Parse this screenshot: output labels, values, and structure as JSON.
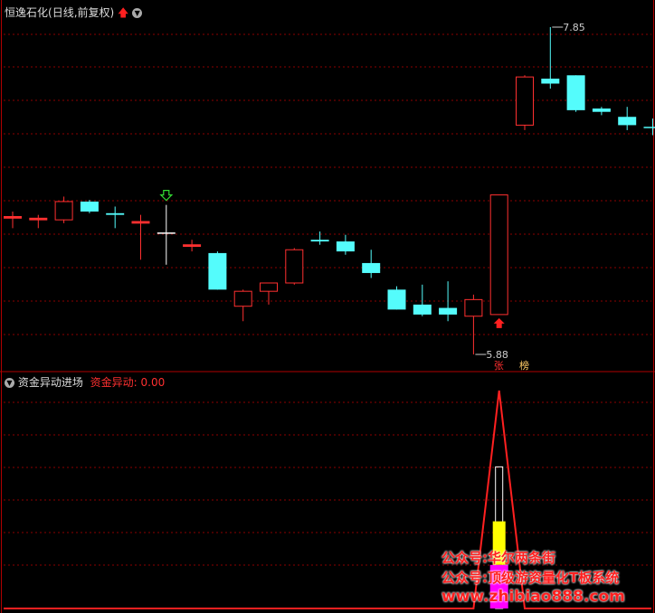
{
  "header": {
    "stock_name": "恒逸石化",
    "mode": "(日线,前复权)",
    "up_arrow_icon": "red-up-arrow-icon",
    "dropdown_icon": "chevron-down-circle-icon"
  },
  "indicator": {
    "name": "资金异动进场",
    "value_label": "资金异动:",
    "value": "0.00"
  },
  "annotations": {
    "high_label": "7.85",
    "low_label": "5.88",
    "tag_zhang": "张",
    "tag_bang": "榜"
  },
  "watermark": {
    "line1": "公众号:华尔两条街",
    "line2": "公众号:顶级游资量化T板系统",
    "line3": "www.zhibiao888.com"
  },
  "colors": {
    "up": "#ff3030",
    "down": "#54fcfc",
    "doji": "#ffffff",
    "grid": "#8b0000",
    "volume_line": "#ff2020",
    "bar_yellow": "#ffff00",
    "bar_magenta": "#ff00ff",
    "bar_white": "#ffffff"
  },
  "chart_data": {
    "type": "candlestick",
    "price_range": [
      5.8,
      8.0
    ],
    "candles": [
      {
        "o": 6.71,
        "h": 6.74,
        "l": 6.64,
        "c": 6.7,
        "color": "up"
      },
      {
        "o": 6.69,
        "h": 6.72,
        "l": 6.64,
        "c": 6.7,
        "color": "up"
      },
      {
        "o": 6.69,
        "h": 6.83,
        "l": 6.67,
        "c": 6.8,
        "color": "up"
      },
      {
        "o": 6.8,
        "h": 6.81,
        "l": 6.73,
        "c": 6.74,
        "color": "down"
      },
      {
        "o": 6.73,
        "h": 6.77,
        "l": 6.64,
        "c": 6.72,
        "color": "down"
      },
      {
        "o": 6.68,
        "h": 6.72,
        "l": 6.45,
        "c": 6.67,
        "color": "up"
      },
      {
        "o": 6.61,
        "h": 6.78,
        "l": 6.42,
        "c": 6.61,
        "color": "doji"
      },
      {
        "o": 6.53,
        "h": 6.57,
        "l": 6.5,
        "c": 6.54,
        "color": "up"
      },
      {
        "o": 6.49,
        "h": 6.5,
        "l": 6.27,
        "c": 6.27,
        "color": "down"
      },
      {
        "o": 6.17,
        "h": 6.27,
        "l": 6.08,
        "c": 6.26,
        "color": "up"
      },
      {
        "o": 6.26,
        "h": 6.31,
        "l": 6.18,
        "c": 6.31,
        "color": "up"
      },
      {
        "o": 6.31,
        "h": 6.52,
        "l": 6.3,
        "c": 6.51,
        "color": "up"
      },
      {
        "o": 6.57,
        "h": 6.62,
        "l": 6.54,
        "c": 6.56,
        "color": "down"
      },
      {
        "o": 6.56,
        "h": 6.6,
        "l": 6.48,
        "c": 6.5,
        "color": "down"
      },
      {
        "o": 6.43,
        "h": 6.51,
        "l": 6.34,
        "c": 6.37,
        "color": "down"
      },
      {
        "o": 6.27,
        "h": 6.29,
        "l": 6.15,
        "c": 6.15,
        "color": "down"
      },
      {
        "o": 6.18,
        "h": 6.3,
        "l": 6.11,
        "c": 6.12,
        "color": "down"
      },
      {
        "o": 6.16,
        "h": 6.32,
        "l": 6.08,
        "c": 6.12,
        "color": "down"
      },
      {
        "o": 6.11,
        "h": 6.24,
        "l": 5.88,
        "c": 6.21,
        "color": "up"
      },
      {
        "o": 6.12,
        "h": 6.84,
        "l": 6.12,
        "c": 6.84,
        "color": "up"
      },
      {
        "o": 7.26,
        "h": 7.56,
        "l": 7.23,
        "c": 7.55,
        "color": "up"
      },
      {
        "o": 7.54,
        "h": 7.85,
        "l": 7.48,
        "c": 7.51,
        "color": "down"
      },
      {
        "o": 7.56,
        "h": 7.56,
        "l": 7.34,
        "c": 7.35,
        "color": "down"
      },
      {
        "o": 7.36,
        "h": 7.37,
        "l": 7.32,
        "c": 7.34,
        "color": "down"
      },
      {
        "o": 7.31,
        "h": 7.37,
        "l": 7.23,
        "c": 7.26,
        "color": "down"
      },
      {
        "o": 7.25,
        "h": 7.3,
        "l": 7.2,
        "c": 7.25,
        "color": "down"
      }
    ],
    "signal_down_index": 6,
    "signal_up_index": 19,
    "indicator_triangle": {
      "peak_index": 19,
      "peak_value": 1.0
    },
    "indicator_bars": {
      "index": 19,
      "magenta": 0.2,
      "yellow": 0.4,
      "white": 0.65
    }
  }
}
